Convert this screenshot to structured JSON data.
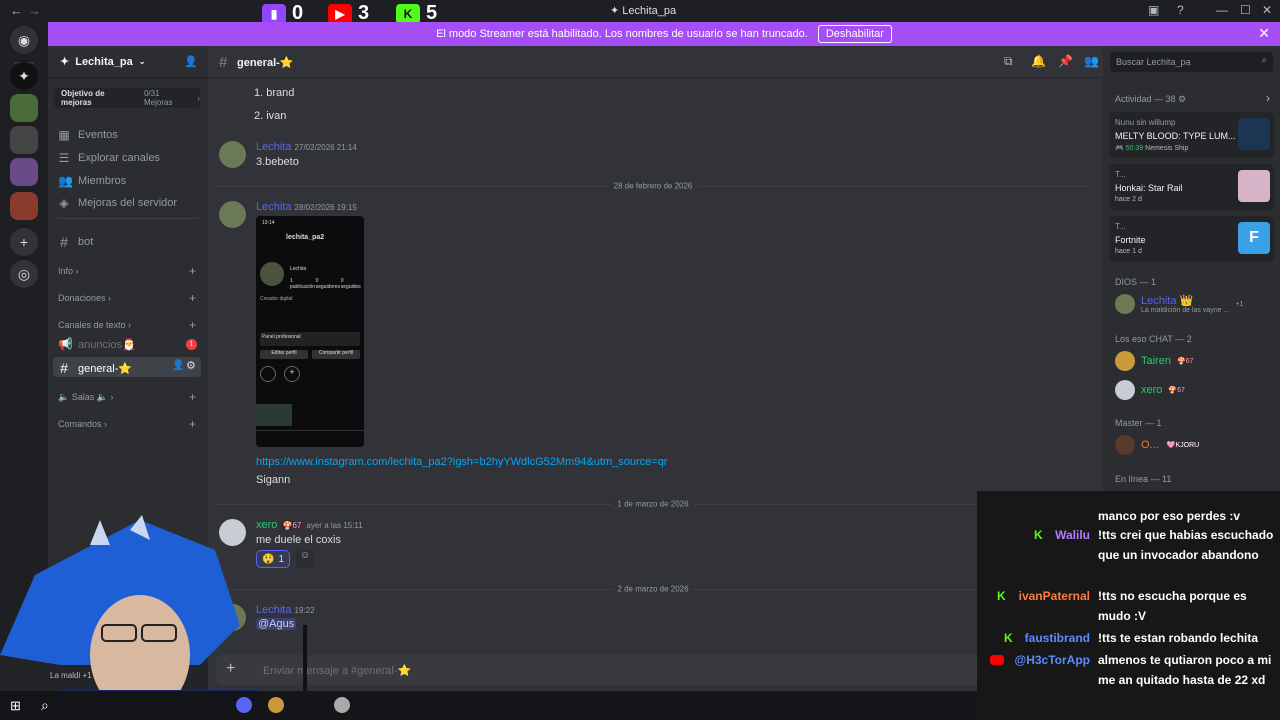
{
  "titlebar": {
    "title": "Lechita_pa",
    "back": "←",
    "forward": "→",
    "counters": [
      {
        "icon": "twitch-icon",
        "value": "0",
        "color": "#9146ff"
      },
      {
        "icon": "youtube-icon",
        "value": "3",
        "color": "#ff0000"
      },
      {
        "icon": "kick-icon",
        "value": "5",
        "color": "#53fc18"
      }
    ]
  },
  "banner": {
    "text": "El modo Streamer está habilitado. Los nombres de usuario se han truncado.",
    "button": "Deshabilitar"
  },
  "server": {
    "name": "Lechita_pa",
    "boost_label": "Objetivo de mejoras",
    "boost_count": "0/31 Mejoras",
    "menu": [
      "Eventos",
      "Explorar canales",
      "Miembros",
      "Mejoras del servidor"
    ],
    "bot_channel": "bot",
    "categories": [
      "Info",
      "Donaciones",
      "Canales de texto",
      "Salas 🔈",
      "Comandos"
    ],
    "channels": {
      "anuncios": "anuncios🎅",
      "anuncios_badge": "1",
      "general": "general-⭐"
    }
  },
  "channel": {
    "name": "general-⭐",
    "search_placeholder": "Buscar Lechita_pa"
  },
  "messages": {
    "list_items": [
      "1. brand",
      "2. ivan"
    ],
    "m1": {
      "user": "Lechita",
      "time": "27/02/2026 21:14",
      "text": "3.bebeto"
    },
    "divider1": "28 de febrero de 2026",
    "m2": {
      "user": "Lechita",
      "time": "28/02/2026 19:15",
      "link": "https://www.instagram.com/lechita_pa2?igsh=b2hyYWdlcG52Mm94&utm_source=qr",
      "text": "Sigann"
    },
    "embed": {
      "handle": "lechita_pa2",
      "name": "Lechita",
      "stats": [
        "1 publicación",
        "0 seguidores",
        "0 seguidos"
      ],
      "bio": "Creador digital",
      "panel": "Panel profesional",
      "edit": "Editar perfil",
      "share": "Compartir perfil"
    },
    "divider2": "1 de marzo de 2026",
    "m3": {
      "user": "xero",
      "badge": "67",
      "time": "ayer a las 15:11",
      "text": "me duele el coxis",
      "reaction": "1"
    },
    "divider3": "2 de marzo de 2026",
    "m4": {
      "user": "Lechita",
      "time": "19:22",
      "mention": "@Agus"
    }
  },
  "composer": {
    "placeholder": "Enviar mensaje a #general-⭐"
  },
  "activity": {
    "title": "Actividad — 38",
    "cards": [
      {
        "who": "Nunu sin willump",
        "game": "MELTY BLOOD: TYPE LUM...",
        "time": "50:39",
        "extra": "Nemesis Ship"
      },
      {
        "who": "T...",
        "game": "Honkai: Star Rail",
        "time": "hace 2 d"
      },
      {
        "who": "T...",
        "game": "Fortnite",
        "time": "hace 1 d"
      }
    ]
  },
  "members": {
    "dios_title": "DIOS — 1",
    "dios": {
      "name": "Lechita",
      "status": "La maldición de las vayne ...",
      "extra": "+1"
    },
    "chat_title": "Los eso CHAT — 2",
    "chat": [
      {
        "name": "Tairen",
        "badge": "67"
      },
      {
        "name": "xero",
        "badge": "67"
      }
    ],
    "master_title": "Master — 1",
    "master": {
      "name": "O...",
      "tag": "KJORU"
    },
    "online_title": "En línea — 11"
  },
  "user_panel": {
    "status": "La maldi +1"
  },
  "overlay_chat": [
    {
      "user": "",
      "platform": "",
      "text": "manco por eso perdes :v"
    },
    {
      "user": "Walilu",
      "platform": "kick",
      "color": "#b57bff",
      "text": "!tts crei que habias escuchado que un invocador abandono"
    },
    {
      "user": "ivanPaternal",
      "platform": "kick",
      "color": "#ff7a3d",
      "text": "!tts no escucha porque es mudo :V"
    },
    {
      "user": "faustibrand",
      "platform": "kick",
      "color": "#5b8cff",
      "text": "!tts te estan robando lechita"
    },
    {
      "user": "@H3cTorApp",
      "platform": "youtube",
      "color": "#5b8cff",
      "text": "almenos te qutiaron poco a mi me an quitado hasta de 22 xd"
    }
  ]
}
